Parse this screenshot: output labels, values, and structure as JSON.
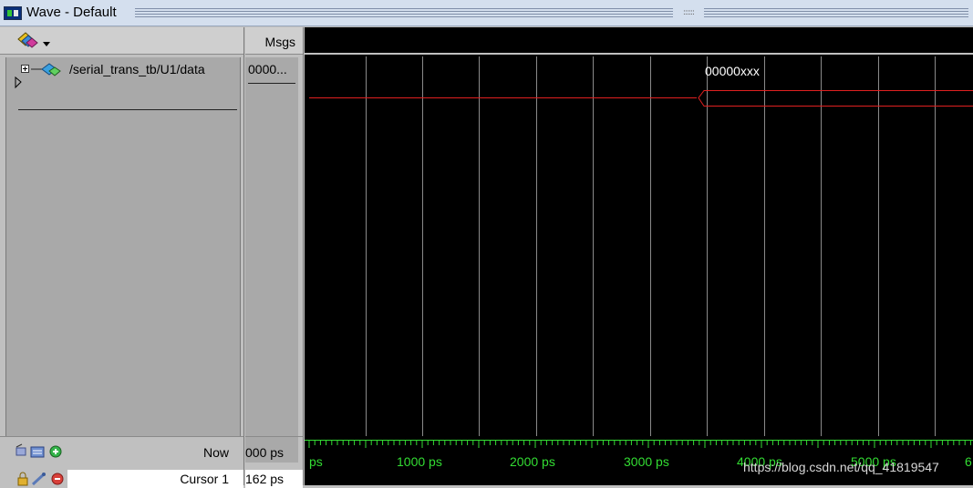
{
  "window": {
    "title": "Wave - Default"
  },
  "icons": {
    "title": "wave-window-icon",
    "add_wave": "add-wave-icon",
    "footer_tools": [
      "tool-a-icon",
      "tool-b-icon",
      "add-cursor-icon"
    ],
    "cursor_tools": [
      "lock-icon",
      "edit-icon",
      "remove-cursor-icon"
    ]
  },
  "colors": {
    "wave_background": "#000000",
    "wave_signal": "#e02020",
    "grid": "#8a8a8a",
    "timeline": "#33dd33",
    "pane_background": "#c0c0c0"
  },
  "columns": {
    "msgs": "Msgs"
  },
  "signal": {
    "name": "/serial_trans_tb/U1/data",
    "msg_value": "0000...",
    "wave_value": "00000xxx"
  },
  "footer": {
    "now_label": "Now",
    "now_value": "000 ps",
    "cursor_label": "Cursor 1",
    "cursor_value": "162 ps"
  },
  "timeline": {
    "labels": [
      "ps",
      "1000 ps",
      "2000 ps",
      "3000 ps",
      "4000 ps",
      "5000 ps",
      "6"
    ]
  },
  "watermark": "https://blog.csdn.net/qq_41819547"
}
